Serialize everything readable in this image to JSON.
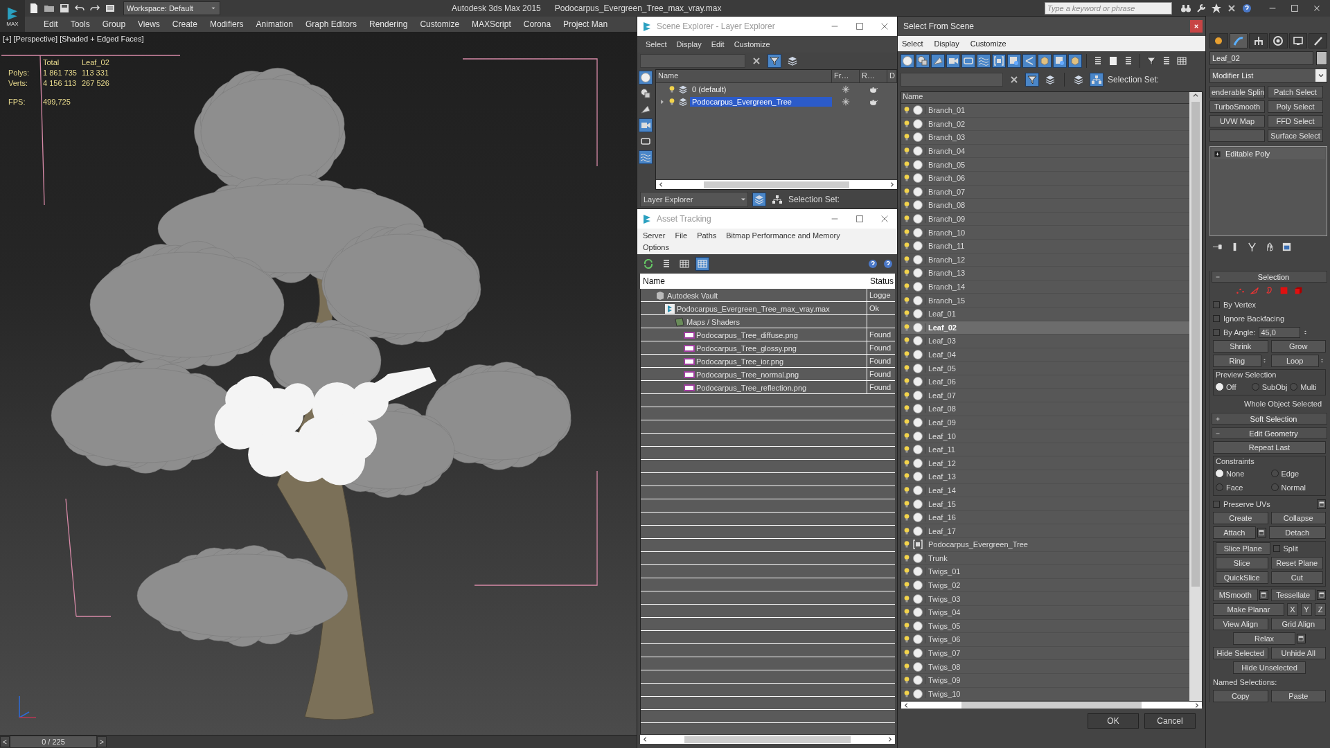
{
  "title_bar": {
    "logo": "MAX",
    "workspace": "Workspace: Default",
    "app": "Autodesk 3ds Max  2015",
    "file": "Podocarpus_Evergreen_Tree_max_vray.max",
    "search_placeholder": "Type a keyword or phrase"
  },
  "menu": [
    "Edit",
    "Tools",
    "Group",
    "Views",
    "Create",
    "Modifiers",
    "Animation",
    "Graph Editors",
    "Rendering",
    "Customize",
    "MAXScript",
    "Corona",
    "Project Man"
  ],
  "viewport": {
    "labels": [
      "[+]",
      "[Perspective]",
      "[Shaded + Edged Faces]"
    ],
    "stats": {
      "headers": [
        "Total",
        "Leaf_02"
      ],
      "rows": [
        {
          "label": "Polys:",
          "values": [
            "1 861 735",
            "113 331"
          ]
        },
        {
          "label": "Verts:",
          "values": [
            "4 156 113",
            "267 526"
          ]
        }
      ],
      "fps_label": "FPS:",
      "fps": "499,725"
    }
  },
  "timeline": {
    "frame": "0 / 225",
    "prev": "<",
    "next": ">"
  },
  "scene_explorer": {
    "title": "Scene Explorer - Layer Explorer",
    "menu": [
      "Select",
      "Display",
      "Edit",
      "Customize"
    ],
    "filter_on": true,
    "side_tools": [
      {
        "on": true
      },
      {
        "on": false
      },
      {
        "on": false
      },
      {
        "on": true
      },
      {
        "on": false
      },
      {
        "on": true
      }
    ],
    "columns": [
      "Name",
      "Fr…",
      "R…",
      "D"
    ],
    "layers": [
      {
        "name": "0 (default)",
        "selected": false,
        "expandable": false
      },
      {
        "name": "Podocarpus_Evergreen_Tree",
        "selected": true,
        "expandable": true
      }
    ],
    "footer_mode": "Layer Explorer",
    "selection_set": "Selection Set:"
  },
  "asset_tracking": {
    "title": "Asset Tracking",
    "menu": [
      "Server",
      "File",
      "Paths",
      "Bitmap Performance and Memory",
      "Options"
    ],
    "tools": [
      {
        "on": false
      },
      {
        "on": false
      },
      {
        "on": false
      },
      {
        "on": true
      }
    ],
    "columns": [
      "Name",
      "Status"
    ],
    "rows": [
      {
        "kind": "vault",
        "name": "Autodesk Vault",
        "status": "Logge",
        "children": [
          {
            "kind": "max",
            "name": "Podocarpus_Evergreen_Tree_max_vray.max",
            "status": "Ok",
            "children": [
              {
                "kind": "folder",
                "name": "Maps / Shaders",
                "children": [
                  {
                    "kind": "png",
                    "name": "Podocarpus_Tree_diffuse.png",
                    "status": "Found"
                  },
                  {
                    "kind": "png",
                    "name": "Podocarpus_Tree_glossy.png",
                    "status": "Found"
                  },
                  {
                    "kind": "png",
                    "name": "Podocarpus_Tree_ior.png",
                    "status": "Found"
                  },
                  {
                    "kind": "png",
                    "name": "Podocarpus_Tree_normal.png",
                    "status": "Found"
                  },
                  {
                    "kind": "png",
                    "name": "Podocarpus_Tree_reflection.png",
                    "status": "Found"
                  }
                ]
              }
            ]
          }
        ]
      }
    ]
  },
  "select_from_scene": {
    "title": "Select From Scene",
    "menu": [
      "Select",
      "Display",
      "Customize"
    ],
    "filters": [
      {
        "on": true
      },
      {
        "on": true
      },
      {
        "on": true
      },
      {
        "on": true
      },
      {
        "on": true
      },
      {
        "on": true
      },
      {
        "on": true
      },
      {
        "on": true
      },
      {
        "on": true
      },
      {
        "on": true
      },
      {
        "on": true
      },
      {
        "on": true
      }
    ],
    "filter_toggle_on": true,
    "hierarchy_on": true,
    "selection_set": "Selection Set:",
    "column": "Name",
    "items": [
      {
        "name": "Branch_01",
        "kind": "object",
        "selected": false
      },
      {
        "name": "Branch_02",
        "kind": "object",
        "selected": false
      },
      {
        "name": "Branch_03",
        "kind": "object",
        "selected": false
      },
      {
        "name": "Branch_04",
        "kind": "object",
        "selected": false
      },
      {
        "name": "Branch_05",
        "kind": "object",
        "selected": false
      },
      {
        "name": "Branch_06",
        "kind": "object",
        "selected": false
      },
      {
        "name": "Branch_07",
        "kind": "object",
        "selected": false
      },
      {
        "name": "Branch_08",
        "kind": "object",
        "selected": false
      },
      {
        "name": "Branch_09",
        "kind": "object",
        "selected": false
      },
      {
        "name": "Branch_10",
        "kind": "object",
        "selected": false
      },
      {
        "name": "Branch_11",
        "kind": "object",
        "selected": false
      },
      {
        "name": "Branch_12",
        "kind": "object",
        "selected": false
      },
      {
        "name": "Branch_13",
        "kind": "object",
        "selected": false
      },
      {
        "name": "Branch_14",
        "kind": "object",
        "selected": false
      },
      {
        "name": "Branch_15",
        "kind": "object",
        "selected": false
      },
      {
        "name": "Leaf_01",
        "kind": "object",
        "selected": false
      },
      {
        "name": "Leaf_02",
        "kind": "object",
        "selected": true
      },
      {
        "name": "Leaf_03",
        "kind": "object",
        "selected": false
      },
      {
        "name": "Leaf_04",
        "kind": "object",
        "selected": false
      },
      {
        "name": "Leaf_05",
        "kind": "object",
        "selected": false
      },
      {
        "name": "Leaf_06",
        "kind": "object",
        "selected": false
      },
      {
        "name": "Leaf_07",
        "kind": "object",
        "selected": false
      },
      {
        "name": "Leaf_08",
        "kind": "object",
        "selected": false
      },
      {
        "name": "Leaf_09",
        "kind": "object",
        "selected": false
      },
      {
        "name": "Leaf_10",
        "kind": "object",
        "selected": false
      },
      {
        "name": "Leaf_11",
        "kind": "object",
        "selected": false
      },
      {
        "name": "Leaf_12",
        "kind": "object",
        "selected": false
      },
      {
        "name": "Leaf_13",
        "kind": "object",
        "selected": false
      },
      {
        "name": "Leaf_14",
        "kind": "object",
        "selected": false
      },
      {
        "name": "Leaf_15",
        "kind": "object",
        "selected": false
      },
      {
        "name": "Leaf_16",
        "kind": "object",
        "selected": false
      },
      {
        "name": "Leaf_17",
        "kind": "object",
        "selected": false
      },
      {
        "name": "Podocarpus_Evergreen_Tree",
        "kind": "group",
        "selected": false
      },
      {
        "name": "Trunk",
        "kind": "object",
        "selected": false
      },
      {
        "name": "Twigs_01",
        "kind": "object",
        "selected": false
      },
      {
        "name": "Twigs_02",
        "kind": "object",
        "selected": false
      },
      {
        "name": "Twigs_03",
        "kind": "object",
        "selected": false
      },
      {
        "name": "Twigs_04",
        "kind": "object",
        "selected": false
      },
      {
        "name": "Twigs_05",
        "kind": "object",
        "selected": false
      },
      {
        "name": "Twigs_06",
        "kind": "object",
        "selected": false
      },
      {
        "name": "Twigs_07",
        "kind": "object",
        "selected": false
      },
      {
        "name": "Twigs_08",
        "kind": "object",
        "selected": false
      },
      {
        "name": "Twigs_09",
        "kind": "object",
        "selected": false
      },
      {
        "name": "Twigs_10",
        "kind": "object",
        "selected": false
      }
    ],
    "buttons": [
      "OK",
      "Cancel"
    ]
  },
  "command_panel": {
    "tabs": [
      {
        "selected": false
      },
      {
        "selected": true
      },
      {
        "selected": false
      },
      {
        "selected": false
      },
      {
        "selected": false
      },
      {
        "selected": false
      }
    ],
    "object_name": "Leaf_02",
    "modifier_list": "Modifier List",
    "modifier_buttons": [
      {
        "kind": "button",
        "label": "enderable Splin"
      },
      {
        "kind": "button",
        "label": "Patch Select"
      },
      {
        "kind": "button",
        "label": "TurboSmooth"
      },
      {
        "kind": "button",
        "label": "Poly Select"
      },
      {
        "kind": "button",
        "label": "UVW Map"
      },
      {
        "kind": "button",
        "label": "FFD Select"
      },
      {
        "kind": "blank"
      },
      {
        "kind": "button",
        "label": "Surface Select"
      }
    ],
    "stack": [
      {
        "name": "Editable Poly",
        "expanded": false
      }
    ],
    "rollouts": [
      {
        "title": "Selection",
        "expanded": true,
        "rows": [
          [
            {
              "kind": "subobject"
            }
          ],
          [
            {
              "kind": "check",
              "label": "By Vertex",
              "checked": false
            }
          ],
          [
            {
              "kind": "check",
              "label": "Ignore Backfacing",
              "checked": false
            }
          ],
          [
            {
              "kind": "check_value",
              "label": "By Angle:",
              "checked": false,
              "value": "45,0"
            }
          ],
          [
            {
              "kind": "button",
              "label": "Shrink"
            },
            {
              "kind": "button",
              "label": "Grow"
            }
          ],
          [
            {
              "kind": "button_spinner",
              "label": "Ring"
            },
            {
              "kind": "button_spinner",
              "label": "Loop"
            }
          ],
          [
            {
              "kind": "group",
              "title": "Preview Selection",
              "rows": [
                [
                  {
                    "kind": "radio",
                    "label": "Off",
                    "selected": true
                  },
                  {
                    "kind": "radio",
                    "label": "SubObj",
                    "selected": false
                  },
                  {
                    "kind": "radio",
                    "label": "Multi",
                    "selected": false
                  }
                ]
              ]
            }
          ],
          [
            {
              "kind": "note",
              "text": "Whole Object Selected"
            }
          ]
        ]
      },
      {
        "title": "Soft Selection",
        "expanded": false
      },
      {
        "title": "Edit Geometry",
        "expanded": true,
        "rows": [
          [
            {
              "kind": "button",
              "label": "Repeat Last"
            }
          ],
          [
            {
              "kind": "group",
              "title": "Constraints",
              "rows": [
                [
                  {
                    "kind": "radio",
                    "label": "None",
                    "selected": true
                  },
                  {
                    "kind": "radio",
                    "label": "Edge",
                    "selected": false
                  }
                ],
                [
                  {
                    "kind": "radio",
                    "label": "Face",
                    "selected": false
                  },
                  {
                    "kind": "radio",
                    "label": "Normal",
                    "selected": false
                  }
                ]
              ]
            }
          ],
          [
            {
              "kind": "check",
              "label": "Preserve UVs",
              "checked": false
            },
            {
              "kind": "settings"
            }
          ],
          [
            {
              "kind": "button",
              "label": "Create"
            },
            {
              "kind": "button",
              "label": "Collapse"
            }
          ],
          [
            {
              "kind": "button_settings",
              "label": "Attach"
            },
            {
              "kind": "button",
              "label": "Detach"
            }
          ],
          [
            {
              "kind": "frame",
              "rows": [
                [
                  {
                    "kind": "button",
                    "label": "Slice Plane"
                  },
                  {
                    "kind": "check",
                    "label": "Split",
                    "checked": false
                  }
                ],
                [
                  {
                    "kind": "button",
                    "label": "Slice"
                  },
                  {
                    "kind": "button",
                    "label": "Reset Plane"
                  }
                ],
                [
                  {
                    "kind": "button",
                    "label": "QuickSlice"
                  },
                  {
                    "kind": "button",
                    "label": "Cut"
                  }
                ]
              ]
            }
          ],
          [
            {
              "kind": "button_settings",
              "label": "MSmooth"
            },
            {
              "kind": "button_settings",
              "label": "Tessellate"
            }
          ],
          [
            {
              "kind": "button",
              "label": "Make Planar"
            },
            {
              "kind": "button_small",
              "label": "X"
            },
            {
              "kind": "button_small",
              "label": "Y"
            },
            {
              "kind": "button_small",
              "label": "Z"
            }
          ],
          [
            {
              "kind": "button",
              "label": "View Align"
            },
            {
              "kind": "button",
              "label": "Grid Align"
            }
          ],
          [
            {
              "kind": "button_settings",
              "label": "Relax"
            }
          ],
          [
            {
              "kind": "button",
              "label": "Hide Selected"
            },
            {
              "kind": "button",
              "label": "Unhide All"
            }
          ],
          [
            {
              "kind": "button",
              "label": "Hide Unselected"
            }
          ],
          [
            {
              "kind": "label",
              "text": "Named Selections:"
            }
          ],
          [
            {
              "kind": "button",
              "label": "Copy"
            },
            {
              "kind": "button",
              "label": "Paste"
            }
          ]
        ]
      }
    ]
  }
}
